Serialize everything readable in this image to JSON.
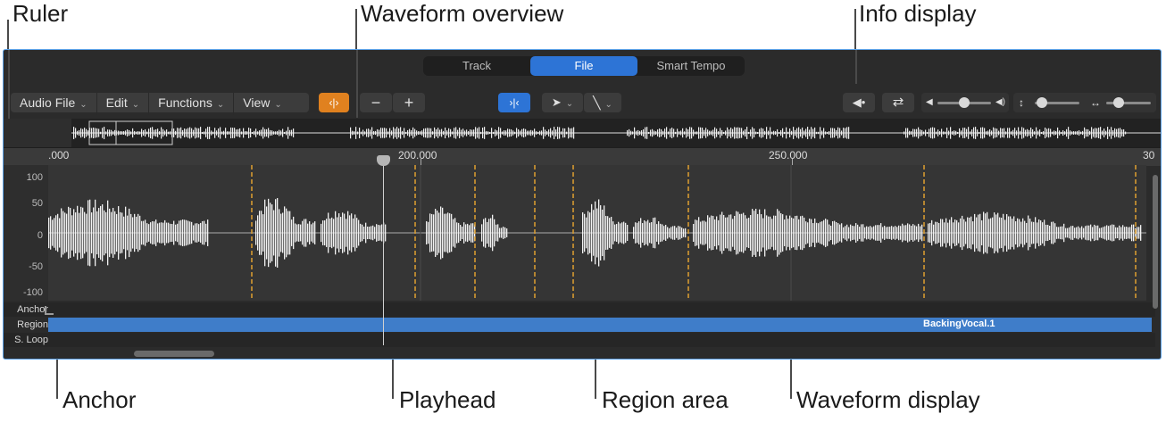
{
  "callouts": {
    "ruler": "Ruler",
    "waveform_overview": "Waveform overview",
    "info_display": "Info display",
    "anchor": "Anchor",
    "playhead": "Playhead",
    "region_area": "Region area",
    "waveform_display": "Waveform display"
  },
  "tabs": [
    {
      "label": "Track",
      "active": false
    },
    {
      "label": "File",
      "active": true
    },
    {
      "label": "Smart Tempo",
      "active": false
    }
  ],
  "menus": {
    "audio_file": "Audio File",
    "edit": "Edit",
    "functions": "Functions",
    "view": "View"
  },
  "ruler": {
    "labels": [
      ".000",
      "200.000",
      "250.000",
      "30"
    ]
  },
  "y_axis": {
    "labels": [
      "100",
      "50",
      "0",
      "-50",
      "-100"
    ]
  },
  "rows": {
    "anchor": "Anchor",
    "region": "Region",
    "sloop": "S. Loop"
  },
  "region": {
    "name": "BackingVocal.1"
  },
  "colors": {
    "accent": "#2d74d6",
    "orange": "#e0811f",
    "region": "#3f7dc9",
    "transient": "#e0a030"
  },
  "icons": [
    "waveform-zoom-icon",
    "minus-icon",
    "plus-icon",
    "tempo-marker-icon",
    "pointer-tool-icon",
    "pencil-tool-icon",
    "speaker-icon",
    "loop-icon",
    "volume-icon",
    "vertical-zoom-icon",
    "horizontal-zoom-icon"
  ]
}
